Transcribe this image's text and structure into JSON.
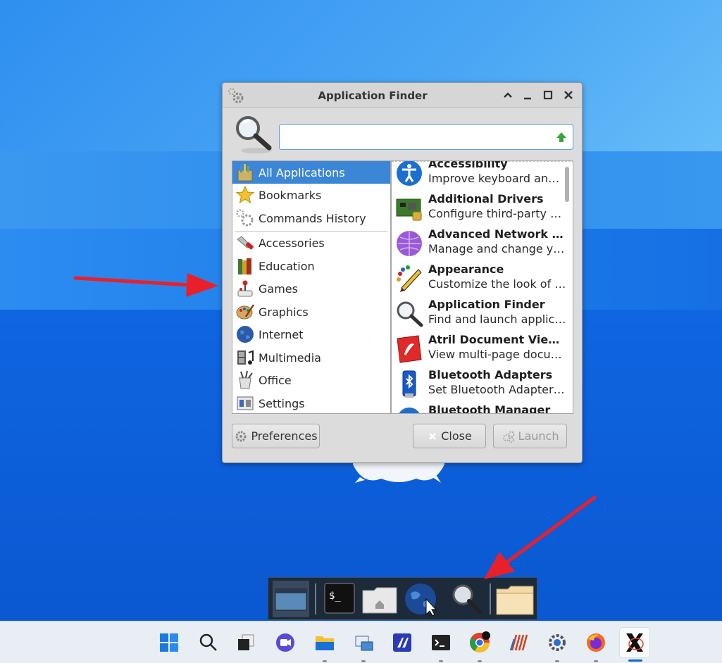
{
  "window": {
    "title": "Application Finder",
    "search": {
      "value": "",
      "placeholder": ""
    }
  },
  "categories": [
    {
      "label": "All Applications",
      "icon": "all-apps-icon",
      "selected": true
    },
    {
      "label": "Bookmarks",
      "icon": "star-icon"
    },
    {
      "label": "Commands History",
      "icon": "gears-icon"
    },
    {
      "label": "Accessories",
      "icon": "knife-icon"
    },
    {
      "label": "Education",
      "icon": "books-icon"
    },
    {
      "label": "Games",
      "icon": "joystick-icon"
    },
    {
      "label": "Graphics",
      "icon": "palette-icon"
    },
    {
      "label": "Internet",
      "icon": "globe-icon"
    },
    {
      "label": "Multimedia",
      "icon": "film-music-icon"
    },
    {
      "label": "Office",
      "icon": "office-icon"
    },
    {
      "label": "Settings",
      "icon": "settings-panel-icon"
    }
  ],
  "apps": [
    {
      "name": "Accessibility",
      "desc": "Improve keyboard and mouse accessibility",
      "icon": "accessibility-icon"
    },
    {
      "name": "Additional Drivers",
      "desc": "Configure third-party and proprietary drivers",
      "icon": "driver-board-icon"
    },
    {
      "name": "Advanced Network Configuration",
      "desc": "Manage and change your network connection settings",
      "icon": "network-icon"
    },
    {
      "name": "Appearance",
      "desc": "Customize the look of your desktop",
      "icon": "appearance-brush-icon"
    },
    {
      "name": "Application Finder",
      "desc": "Find and launch applications installed on your system",
      "icon": "magnifier-icon"
    },
    {
      "name": "Atril Document Viewer",
      "desc": "View multi-page documents",
      "icon": "atril-icon"
    },
    {
      "name": "Bluetooth Adapters",
      "desc": "Set Bluetooth Adapter properties",
      "icon": "bluetooth-usb-icon"
    },
    {
      "name": "Bluetooth Manager",
      "desc": "",
      "icon": "bluetooth-icon"
    }
  ],
  "buttons": {
    "preferences": "Preferences",
    "close": "Close",
    "launch": "Launch"
  },
  "dock": [
    "desktop-icon",
    "terminal-icon",
    "home-folder-icon",
    "web-browser-icon",
    "app-finder-icon",
    "folder-icon"
  ],
  "taskbar": [
    {
      "name": "windows-start-icon"
    },
    {
      "name": "search-icon"
    },
    {
      "name": "task-view-icon"
    },
    {
      "name": "meet-camera-icon"
    },
    {
      "name": "file-explorer-icon"
    },
    {
      "name": "remote-desktop-icon"
    },
    {
      "name": "vscode-like-icon"
    },
    {
      "name": "terminal-icon"
    },
    {
      "name": "chrome-icon"
    },
    {
      "name": "ide-icon"
    },
    {
      "name": "settings-gear-icon"
    },
    {
      "name": "firefox-icon"
    },
    {
      "name": "xwindow-icon",
      "active": true
    }
  ]
}
